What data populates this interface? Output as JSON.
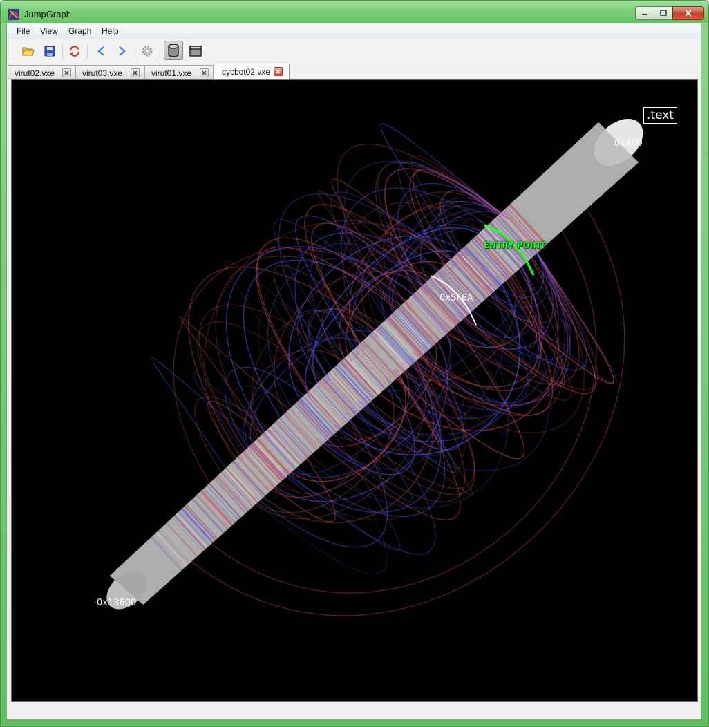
{
  "window": {
    "title": "JumpGraph",
    "app_icon": "jumpgraph-icon"
  },
  "window_controls": {
    "minimize": "minimize-icon",
    "maximize": "maximize-icon",
    "close": "close-icon"
  },
  "menu": [
    "File",
    "View",
    "Graph",
    "Help"
  ],
  "toolbar": {
    "buttons": [
      {
        "icon": "open-folder-icon",
        "pressed": false
      },
      {
        "icon": "save-icon",
        "pressed": false
      },
      {
        "icon": "reload-icon",
        "pressed": false
      },
      {
        "icon": "back-arrow-icon",
        "pressed": false
      },
      {
        "icon": "forward-arrow-icon",
        "pressed": false
      },
      {
        "icon": "gear-icon",
        "pressed": false
      },
      {
        "icon": "cylinder-view-icon",
        "pressed": true
      },
      {
        "icon": "flat-view-icon",
        "pressed": false
      }
    ]
  },
  "tabs": [
    {
      "label": "virut02.vxe",
      "active": false
    },
    {
      "label": "virut03.vxe",
      "active": false
    },
    {
      "label": "virut01.vxe",
      "active": false
    },
    {
      "label": "cycbot02.vxe",
      "active": true
    }
  ],
  "graph": {
    "section_label": ".text",
    "start_address": "0x400",
    "end_address": "0x13600",
    "entry_label": "ENTRY POINT",
    "marker_address": "0x5F6A",
    "colors": {
      "background": "#000000",
      "forward_jump": "#e0505a",
      "backward_jump": "#5a5aff",
      "entry": "#1fff1f",
      "cylinder": "#d8d8d8"
    }
  }
}
